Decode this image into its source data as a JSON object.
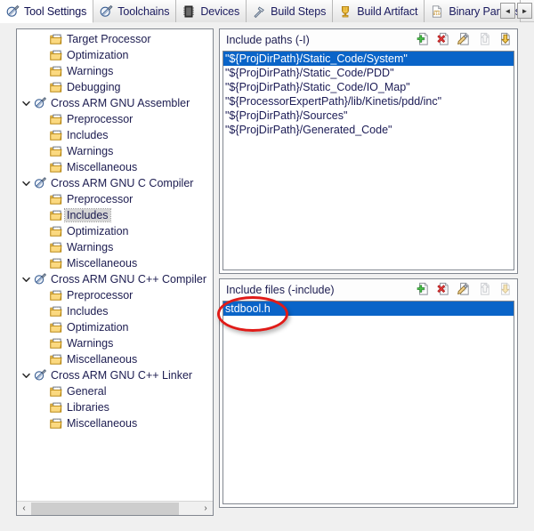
{
  "window": {
    "active_tab": "Tool Settings"
  },
  "tabs": [
    {
      "label": "Tool Settings",
      "icon": "tool-settings-icon",
      "active": true
    },
    {
      "label": "Toolchains",
      "icon": "toolchains-icon",
      "active": false
    },
    {
      "label": "Devices",
      "icon": "devices-chip-icon",
      "active": false
    },
    {
      "label": "Build Steps",
      "icon": "build-steps-hammer-icon",
      "active": false
    },
    {
      "label": "Build Artifact",
      "icon": "build-artifact-icon",
      "active": false
    },
    {
      "label": "Binary Parsers",
      "icon": "binary-parsers-icon",
      "active": false
    }
  ],
  "tab_nav": {
    "prev_label": "◄",
    "next_label": "►"
  },
  "tree": {
    "items": [
      {
        "label": "Target Processor",
        "level": 1,
        "twisty": "none",
        "icon": "page-settings-icon",
        "selected": false
      },
      {
        "label": "Optimization",
        "level": 1,
        "twisty": "none",
        "icon": "page-settings-icon",
        "selected": false
      },
      {
        "label": "Warnings",
        "level": 1,
        "twisty": "none",
        "icon": "page-settings-icon",
        "selected": false
      },
      {
        "label": "Debugging",
        "level": 1,
        "twisty": "none",
        "icon": "page-settings-icon",
        "selected": false
      },
      {
        "label": "Cross ARM GNU Assembler",
        "level": 0,
        "twisty": "expanded",
        "icon": "toolchain-icon",
        "selected": false
      },
      {
        "label": "Preprocessor",
        "level": 1,
        "twisty": "none",
        "icon": "page-settings-icon",
        "selected": false
      },
      {
        "label": "Includes",
        "level": 1,
        "twisty": "none",
        "icon": "page-settings-icon",
        "selected": false
      },
      {
        "label": "Warnings",
        "level": 1,
        "twisty": "none",
        "icon": "page-settings-icon",
        "selected": false
      },
      {
        "label": "Miscellaneous",
        "level": 1,
        "twisty": "none",
        "icon": "page-settings-icon",
        "selected": false
      },
      {
        "label": "Cross ARM GNU C Compiler",
        "level": 0,
        "twisty": "expanded",
        "icon": "toolchain-icon",
        "selected": false
      },
      {
        "label": "Preprocessor",
        "level": 1,
        "twisty": "none",
        "icon": "page-settings-icon",
        "selected": false
      },
      {
        "label": "Includes",
        "level": 1,
        "twisty": "none",
        "icon": "page-settings-icon",
        "selected": true
      },
      {
        "label": "Optimization",
        "level": 1,
        "twisty": "none",
        "icon": "page-settings-icon",
        "selected": false
      },
      {
        "label": "Warnings",
        "level": 1,
        "twisty": "none",
        "icon": "page-settings-icon",
        "selected": false
      },
      {
        "label": "Miscellaneous",
        "level": 1,
        "twisty": "none",
        "icon": "page-settings-icon",
        "selected": false
      },
      {
        "label": "Cross ARM GNU C++ Compiler",
        "level": 0,
        "twisty": "expanded",
        "icon": "toolchain-icon",
        "selected": false
      },
      {
        "label": "Preprocessor",
        "level": 1,
        "twisty": "none",
        "icon": "page-settings-icon",
        "selected": false
      },
      {
        "label": "Includes",
        "level": 1,
        "twisty": "none",
        "icon": "page-settings-icon",
        "selected": false
      },
      {
        "label": "Optimization",
        "level": 1,
        "twisty": "none",
        "icon": "page-settings-icon",
        "selected": false
      },
      {
        "label": "Warnings",
        "level": 1,
        "twisty": "none",
        "icon": "page-settings-icon",
        "selected": false
      },
      {
        "label": "Miscellaneous",
        "level": 1,
        "twisty": "none",
        "icon": "page-settings-icon",
        "selected": false
      },
      {
        "label": "Cross ARM GNU C++ Linker",
        "level": 0,
        "twisty": "expanded",
        "icon": "toolchain-icon",
        "selected": false
      },
      {
        "label": "General",
        "level": 1,
        "twisty": "none",
        "icon": "page-settings-icon",
        "selected": false
      },
      {
        "label": "Libraries",
        "level": 1,
        "twisty": "none",
        "icon": "page-settings-icon",
        "selected": false
      },
      {
        "label": "Miscellaneous",
        "level": 1,
        "twisty": "none",
        "icon": "page-settings-icon",
        "selected": false
      }
    ],
    "scrollbar": {
      "left_arrow": "‹",
      "right_arrow": "›"
    }
  },
  "include_paths_group": {
    "title": "Include paths (-I)",
    "toolbar": [
      {
        "name": "add-icon",
        "enabled": true
      },
      {
        "name": "delete-icon",
        "enabled": true
      },
      {
        "name": "edit-icon",
        "enabled": true
      },
      {
        "name": "move-up-icon",
        "enabled": false
      },
      {
        "name": "move-down-icon",
        "enabled": true
      }
    ],
    "items": [
      {
        "value": "\"${ProjDirPath}/Static_Code/System\"",
        "selected": true
      },
      {
        "value": "\"${ProjDirPath}/Static_Code/PDD\"",
        "selected": false
      },
      {
        "value": "\"${ProjDirPath}/Static_Code/IO_Map\"",
        "selected": false
      },
      {
        "value": "\"${ProcessorExpertPath}/lib/Kinetis/pdd/inc\"",
        "selected": false
      },
      {
        "value": "\"${ProjDirPath}/Sources\"",
        "selected": false
      },
      {
        "value": "\"${ProjDirPath}/Generated_Code\"",
        "selected": false
      }
    ]
  },
  "include_files_group": {
    "title": "Include files (-include)",
    "toolbar": [
      {
        "name": "add-icon",
        "enabled": true
      },
      {
        "name": "delete-icon",
        "enabled": true
      },
      {
        "name": "edit-icon",
        "enabled": true
      },
      {
        "name": "move-up-icon",
        "enabled": false
      },
      {
        "name": "move-down-icon",
        "enabled": false
      }
    ],
    "items": [
      {
        "value": "stdbool.h",
        "selected": true
      }
    ]
  },
  "annotation": {
    "shape": "ellipse",
    "color": "#e01b18",
    "targets": "stdbool.h"
  },
  "colors": {
    "selection_blue": "#0a64c8",
    "tree_text": "#1c1c50",
    "panel_border": "#828790",
    "annotation_red": "#e01b18"
  }
}
